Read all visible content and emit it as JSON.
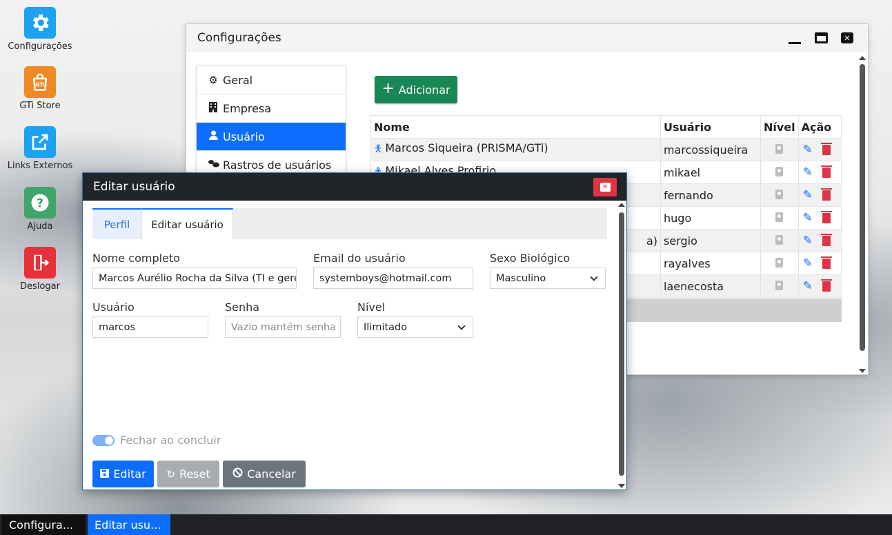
{
  "desktop": {
    "icons": [
      {
        "label": "Configurações",
        "icon": "gear-icon",
        "color": "#1da1f2"
      },
      {
        "label": "GTi Store",
        "icon": "store-bag-icon",
        "color": "#f08a24"
      },
      {
        "label": "Links Externos",
        "icon": "external-link-icon",
        "color": "#1da1f2"
      },
      {
        "label": "Ajuda",
        "icon": "help-icon",
        "color": "#3fa56b"
      },
      {
        "label": "Deslogar",
        "icon": "logout-icon",
        "color": "#e8303a"
      }
    ]
  },
  "main_window": {
    "title": "Configurações",
    "menu": [
      {
        "label": "Geral",
        "icon": "gear-icon"
      },
      {
        "label": "Empresa",
        "icon": "building-icon"
      },
      {
        "label": "Usuário",
        "icon": "user-icon",
        "active": true
      },
      {
        "label": "Rastros de usuários",
        "icon": "footprints-icon"
      }
    ],
    "add_button": "Adicionar",
    "table": {
      "headers": [
        "Nome",
        "Usuário",
        "Nível",
        "Ação"
      ],
      "rows": [
        {
          "nome": "Marcos Siqueira (PRISMA/GTi)",
          "usuario": "marcossiqueira"
        },
        {
          "nome": "Mikael Alves Profirio",
          "usuario": "mikael"
        },
        {
          "nome": "",
          "usuario": "fernando"
        },
        {
          "nome": "",
          "usuario": "hugo"
        },
        {
          "nome": "a)",
          "usuario": "sergio"
        },
        {
          "nome": "",
          "usuario": "rayalves"
        },
        {
          "nome": "",
          "usuario": "laenecosta"
        }
      ]
    }
  },
  "dialog": {
    "title": "Editar usuário",
    "tabs": [
      "Perfil",
      "Editar usuário"
    ],
    "fields": {
      "nome_label": "Nome completo",
      "nome_value": "Marcos Aurélio Rocha da Silva (TI e gere",
      "email_label": "Email do usuário",
      "email_value": "systemboys@hotmail.com",
      "sexo_label": "Sexo Biológico",
      "sexo_value": "Masculino",
      "usuario_label": "Usuário",
      "usuario_value": "marcos",
      "senha_label": "Senha",
      "senha_placeholder": "Vazio mantém senha",
      "nivel_label": "Nível",
      "nivel_value": "Ilimitado"
    },
    "toggle_label": "Fechar ao concluir",
    "buttons": {
      "edit": "Editar",
      "reset": "Reset",
      "cancel": "Cancelar"
    }
  },
  "taskbar": {
    "items": [
      "Configura...",
      "Editar usu..."
    ]
  },
  "colors": {
    "primary": "#0d6efd",
    "success": "#198754",
    "danger": "#dc3545",
    "secondary": "#6c757d",
    "dark": "#212529"
  }
}
